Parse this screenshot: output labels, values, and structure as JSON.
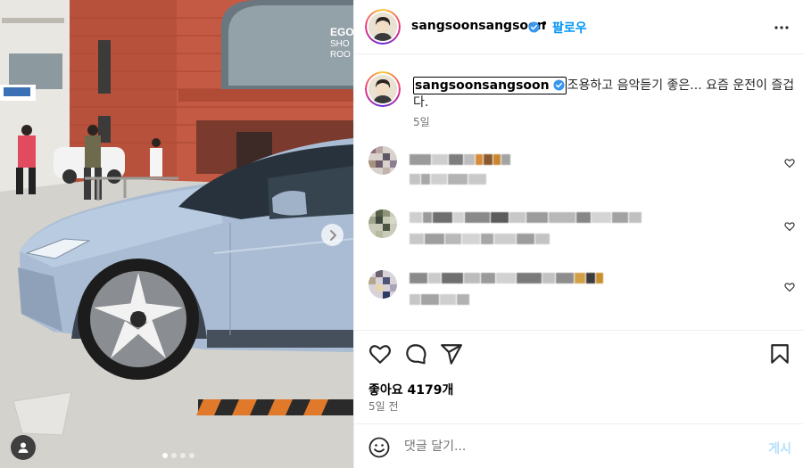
{
  "post": {
    "username": "sangsoonsangsoon",
    "verified": true,
    "follow_label": "팔로우",
    "caption_text": "조용하고 음악듣기 좋은... 요즘 운전이 즐겁다.",
    "caption_age": "5일",
    "likes_label": "좋아요 4179개",
    "posted_ago": "5일 전"
  },
  "comments": [
    {
      "id": "c1"
    },
    {
      "id": "c2"
    },
    {
      "id": "c3"
    }
  ],
  "compose": {
    "placeholder": "댓글 달기...",
    "post_label": "게시"
  },
  "carousel": {
    "slide_count": 4,
    "active_index": 0
  },
  "icons": {
    "more": "more-options-icon",
    "like": "heart-icon",
    "comment": "comment-icon",
    "share": "share-icon",
    "save": "bookmark-icon",
    "emoji": "emoji-icon",
    "next": "chevron-right-icon",
    "tags": "user-tag-icon",
    "verified": "verified-badge-icon"
  },
  "colors": {
    "link": "#0095f6",
    "verified": "#3897f0",
    "secondary_text": "#737373",
    "post_disabled": "#b2dffc"
  }
}
